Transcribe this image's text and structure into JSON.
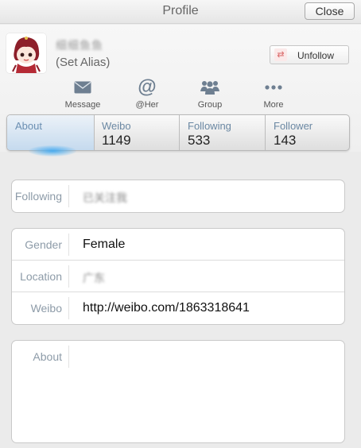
{
  "window": {
    "title": "Profile",
    "close_label": "Close"
  },
  "profile": {
    "username": "细细鱼鱼",
    "alias": "(Set Alias)",
    "unfollow_label": "Unfollow",
    "unfollow_icon": "swap-arrows-icon"
  },
  "actions": [
    {
      "label": "Message",
      "icon": "envelope-icon"
    },
    {
      "label": "@Her",
      "icon": "at-sign-icon"
    },
    {
      "label": "Group",
      "icon": "people-group-icon"
    },
    {
      "label": "More",
      "icon": "more-dots-icon"
    }
  ],
  "tabs": [
    {
      "label": "About",
      "value": ""
    },
    {
      "label": "Weibo",
      "value": "1149"
    },
    {
      "label": "Following",
      "value": "533"
    },
    {
      "label": "Follower",
      "value": "143"
    }
  ],
  "following_section": {
    "label": "Following",
    "value": "已关注我"
  },
  "info_section": [
    {
      "label": "Gender",
      "value": "Female"
    },
    {
      "label": "Location",
      "value": "广东"
    },
    {
      "label": "Weibo",
      "value": "http://weibo.com/1863318641"
    }
  ],
  "about_section": {
    "label": "About",
    "value": ""
  },
  "colors": {
    "accent": "#6b88a3",
    "active_tab": "#c5daee",
    "unfollow_icon": "#d96767"
  }
}
